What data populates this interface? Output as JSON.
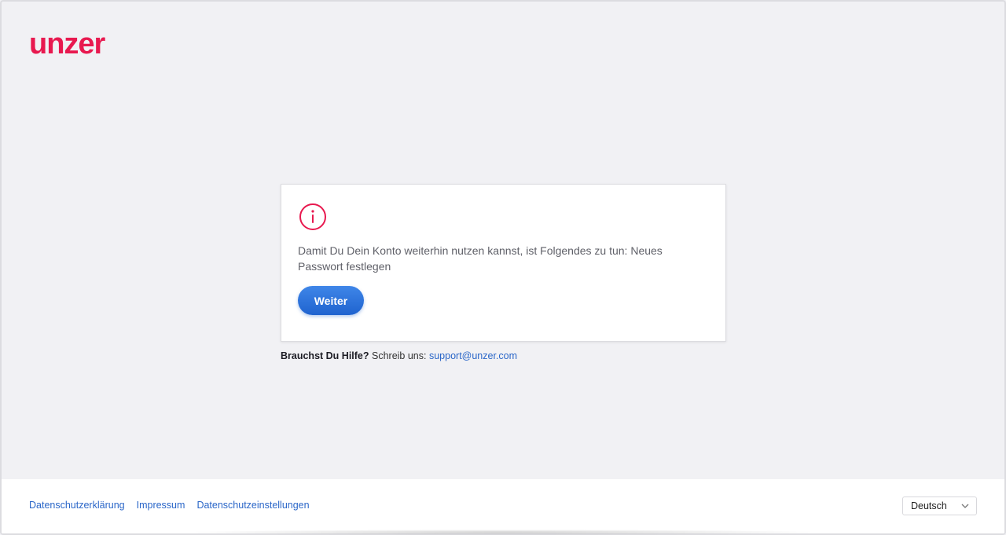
{
  "brand": {
    "logo_text": "unzer",
    "color": "#e8194f"
  },
  "card": {
    "message": "Damit Du Dein Konto weiterhin nutzen kannst, ist Folgendes zu tun: Neues Passwort festlegen",
    "icon": "info-icon",
    "button_label": "Weiter",
    "button_color": "#2a6fdb"
  },
  "help": {
    "question": "Brauchst Du Hilfe?",
    "text": "Schreib uns:",
    "email": "support@unzer.com"
  },
  "footer": {
    "links": [
      "Datenschutzerklärung",
      "Impressum",
      "Datenschutzeinstellungen"
    ],
    "language": "Deutsch",
    "link_color": "#2a66c8"
  }
}
